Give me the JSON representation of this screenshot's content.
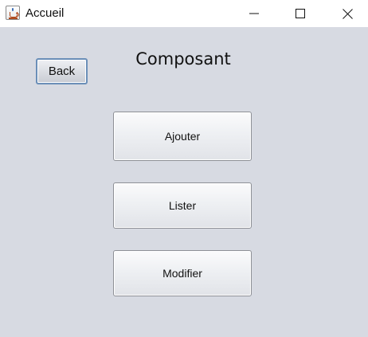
{
  "window": {
    "title": "Accueil",
    "icon": "java-coffee-cup-icon"
  },
  "titlebar_controls": {
    "minimize_icon": "minimize-icon",
    "maximize_icon": "maximize-icon",
    "close_icon": "close-icon"
  },
  "main": {
    "heading": "Composant",
    "back_label": "Back",
    "buttons": [
      {
        "label": "Ajouter"
      },
      {
        "label": "Lister"
      },
      {
        "label": "Modifier"
      }
    ]
  }
}
